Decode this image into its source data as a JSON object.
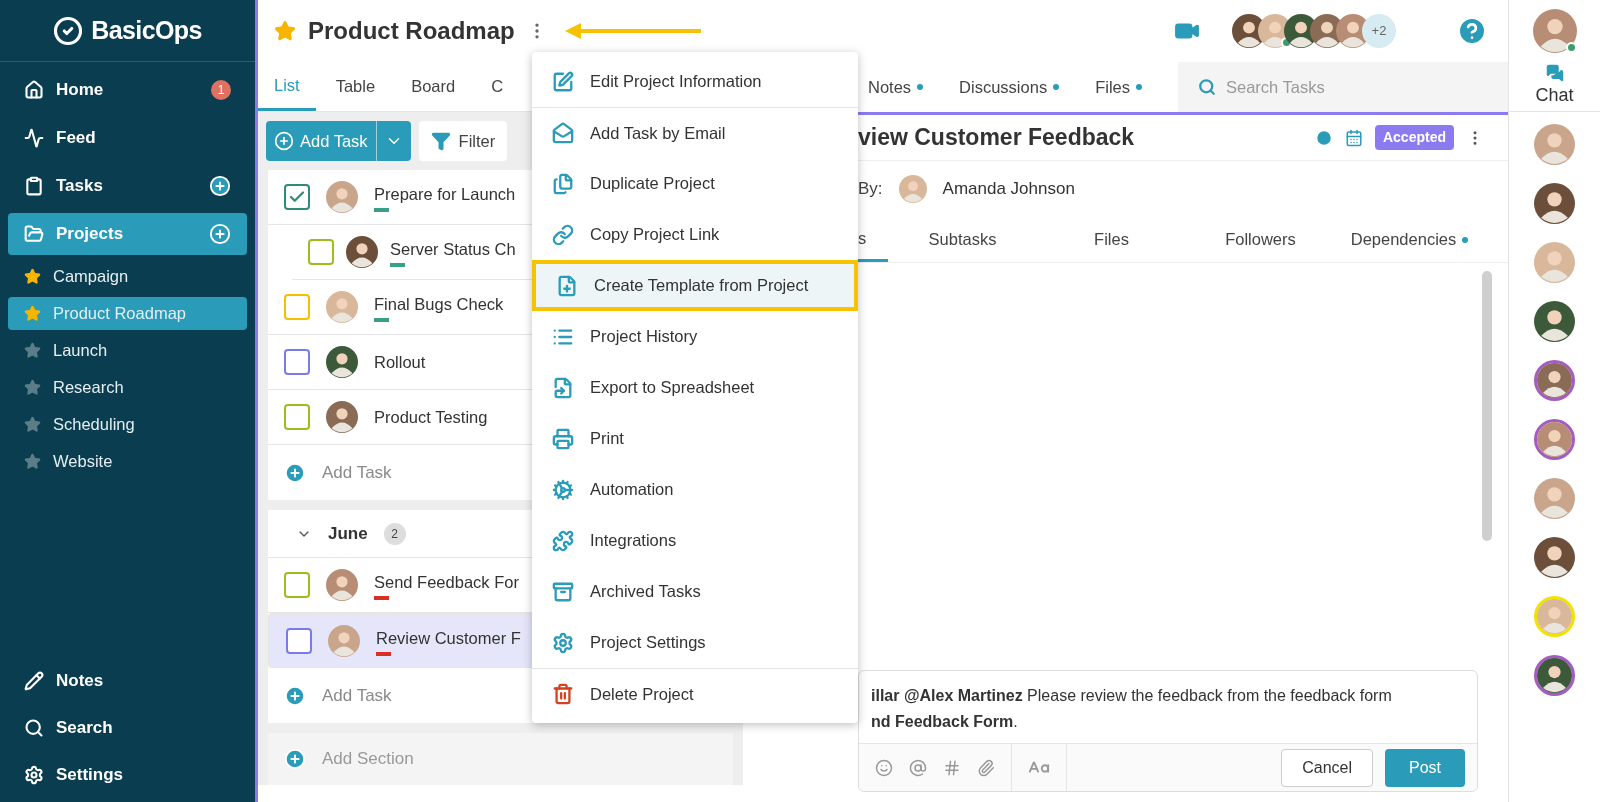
{
  "sidebar": {
    "logo": "BasicOps",
    "nav": [
      {
        "label": "Home",
        "badge": "1",
        "add": false,
        "selected": false
      },
      {
        "label": "Feed",
        "add": false,
        "selected": false
      },
      {
        "label": "Tasks",
        "add": true,
        "selected": false
      },
      {
        "label": "Projects",
        "add": true,
        "selected": true
      }
    ],
    "projects": [
      {
        "label": "Campaign",
        "starred": true,
        "selected": false
      },
      {
        "label": "Product Roadmap",
        "starred": true,
        "selected": true
      },
      {
        "label": "Launch",
        "starred": false,
        "selected": false
      },
      {
        "label": "Research",
        "starred": false,
        "selected": false
      },
      {
        "label": "Scheduling",
        "starred": false,
        "selected": false
      },
      {
        "label": "Website",
        "starred": false,
        "selected": false
      }
    ],
    "bottom": [
      {
        "label": "Notes"
      },
      {
        "label": "Search"
      },
      {
        "label": "Settings"
      }
    ]
  },
  "header": {
    "title": "Product Roadmap",
    "starred": true,
    "extra_members": "+2",
    "members": [
      {
        "online": false
      },
      {
        "online": true
      },
      {
        "online": false
      },
      {
        "online": false
      },
      {
        "online": false
      }
    ]
  },
  "view_tabs": [
    {
      "label": "List",
      "selected": true
    },
    {
      "label": "Table",
      "selected": false
    },
    {
      "label": "Board",
      "selected": false
    },
    {
      "label": "C",
      "selected": false
    }
  ],
  "panel_tabs": [
    {
      "label": "Notes",
      "dot": true
    },
    {
      "label": "Discussions",
      "dot": true
    },
    {
      "label": "Files",
      "dot": true
    }
  ],
  "search": {
    "placeholder": "Search Tasks"
  },
  "toolbar": {
    "add_task": "Add Task",
    "filter": "Filter"
  },
  "list": {
    "groups": [
      {
        "tasks": [
          {
            "name": "Prepare for Launch",
            "checked": true,
            "selected": false,
            "color": "#2e8b7a",
            "flagged": true,
            "urgent": false,
            "children": [
              {
                "name": "Server Status Ch",
                "checked": false,
                "selected": false,
                "color": "#9bbd1e",
                "flagged": true,
                "urgent": false
              }
            ]
          },
          {
            "name": "Final Bugs Check",
            "checked": false,
            "selected": false,
            "color": "#f5c000",
            "flagged": true,
            "urgent": false
          },
          {
            "name": "Rollout",
            "checked": false,
            "selected": false,
            "color": "#7b7be8",
            "flagged": false
          },
          {
            "name": "Product Testing",
            "checked": false,
            "selected": false,
            "color": "#9bbd1e",
            "flagged": false
          }
        ],
        "add": "Add Task"
      },
      {
        "title": "June",
        "count": "2",
        "expanded": true,
        "tasks": [
          {
            "name": "Send Feedback For",
            "checked": false,
            "selected": false,
            "color": "#9bbd1e",
            "flagged": true,
            "urgent": true
          },
          {
            "name": "Review Customer F",
            "checked": false,
            "selected": true,
            "color": "#7b7be8",
            "flagged": true,
            "urgent": true
          }
        ],
        "add": "Add Task"
      }
    ],
    "add_section": "Add Section"
  },
  "menu": [
    {
      "label": "Edit Project Information",
      "kind": "normal",
      "divider_before": false,
      "highlighted": false
    },
    {
      "label": "Add Task by Email",
      "kind": "normal",
      "divider_before": true,
      "highlighted": false
    },
    {
      "label": "Duplicate Project",
      "kind": "normal",
      "divider_before": false,
      "highlighted": false
    },
    {
      "label": "Copy Project Link",
      "kind": "normal",
      "divider_before": false,
      "highlighted": false
    },
    {
      "label": "Create Template from Project",
      "kind": "normal",
      "divider_before": false,
      "highlighted": true
    },
    {
      "label": "Project History",
      "kind": "normal",
      "divider_before": false,
      "highlighted": false
    },
    {
      "label": "Export to Spreadsheet",
      "kind": "normal",
      "divider_before": false,
      "highlighted": false
    },
    {
      "label": "Print",
      "kind": "normal",
      "divider_before": false,
      "highlighted": false
    },
    {
      "label": "Automation",
      "kind": "normal",
      "divider_before": false,
      "highlighted": false
    },
    {
      "label": "Integrations",
      "kind": "normal",
      "divider_before": false,
      "highlighted": false
    },
    {
      "label": "Archived Tasks",
      "kind": "normal",
      "divider_before": false,
      "highlighted": false
    },
    {
      "label": "Project Settings",
      "kind": "normal",
      "divider_before": false,
      "highlighted": false
    },
    {
      "label": "Delete Project",
      "kind": "danger",
      "divider_before": true,
      "highlighted": false
    }
  ],
  "detail": {
    "title": "view Customer Feedback",
    "status": "Accepted",
    "by_label": "By:",
    "by_name": "Amanda Johnson",
    "tabs": [
      {
        "label": "s",
        "selected": true,
        "dot": false
      },
      {
        "label": "Subtasks",
        "selected": false,
        "dot": false
      },
      {
        "label": "Files",
        "selected": false,
        "dot": false
      },
      {
        "label": "Followers",
        "selected": false,
        "dot": false
      },
      {
        "label": "Dependencies",
        "selected": false,
        "dot": true
      }
    ],
    "comment": {
      "line1": "**illar @Alex Martinez** Please review the feedback from the feedback form",
      "line2": "**nd Feedback Form**."
    },
    "cancel": "Cancel",
    "post": "Post"
  },
  "chat": {
    "label": "Chat",
    "me_online": true,
    "users": [
      {
        "ringed": false
      },
      {
        "ringed": false
      },
      {
        "ringed": false
      },
      {
        "ringed": false
      },
      {
        "ringed": true,
        "color": "#a45cc0"
      },
      {
        "ringed": true,
        "color": "#a45cc0"
      },
      {
        "ringed": false
      },
      {
        "ringed": false
      },
      {
        "ringed": true,
        "color": "#f2e200"
      },
      {
        "ringed": true,
        "color": "#a45cc0"
      }
    ]
  }
}
